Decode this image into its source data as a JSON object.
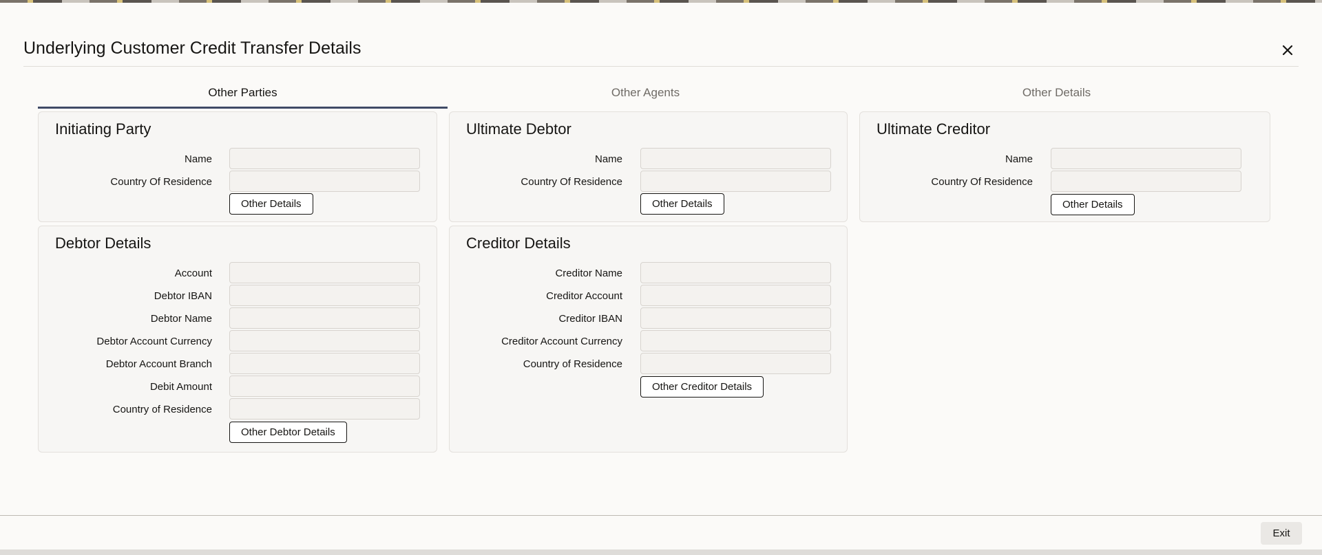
{
  "dialog": {
    "title": "Underlying Customer Credit Transfer Details",
    "close_icon": "close-icon"
  },
  "tabs": [
    {
      "label": "Other Parties",
      "active": true
    },
    {
      "label": "Other Agents",
      "active": false
    },
    {
      "label": "Other Details",
      "active": false
    }
  ],
  "initiating_party": {
    "heading": "Initiating Party",
    "fields": [
      {
        "label": "Name",
        "value": ""
      },
      {
        "label": "Country Of Residence",
        "value": ""
      }
    ],
    "button": "Other Details"
  },
  "ultimate_debtor": {
    "heading": "Ultimate Debtor",
    "fields": [
      {
        "label": "Name",
        "value": ""
      },
      {
        "label": "Country Of Residence",
        "value": ""
      }
    ],
    "button": "Other Details"
  },
  "ultimate_creditor": {
    "heading": "Ultimate Creditor",
    "fields": [
      {
        "label": "Name",
        "value": ""
      },
      {
        "label": "Country Of Residence",
        "value": ""
      }
    ],
    "button": "Other Details"
  },
  "debtor_details": {
    "heading": "Debtor Details",
    "fields": [
      {
        "label": "Account",
        "value": ""
      },
      {
        "label": "Debtor IBAN",
        "value": ""
      },
      {
        "label": "Debtor Name",
        "value": ""
      },
      {
        "label": "Debtor Account Currency",
        "value": ""
      },
      {
        "label": "Debtor Account Branch",
        "value": ""
      },
      {
        "label": "Debit Amount",
        "value": ""
      },
      {
        "label": "Country of Residence",
        "value": ""
      }
    ],
    "button": "Other Debtor Details"
  },
  "creditor_details": {
    "heading": "Creditor Details",
    "fields": [
      {
        "label": "Creditor Name",
        "value": ""
      },
      {
        "label": "Creditor Account",
        "value": ""
      },
      {
        "label": "Creditor IBAN",
        "value": ""
      },
      {
        "label": "Creditor Account Currency",
        "value": ""
      },
      {
        "label": "Country of Residence",
        "value": ""
      }
    ],
    "button": "Other Creditor Details"
  },
  "footer": {
    "exit_label": "Exit"
  },
  "colors": {
    "tab_underline": "#3f4a66",
    "panel_bg": "#f7f6f4",
    "field_border": "#d7d3ce"
  }
}
